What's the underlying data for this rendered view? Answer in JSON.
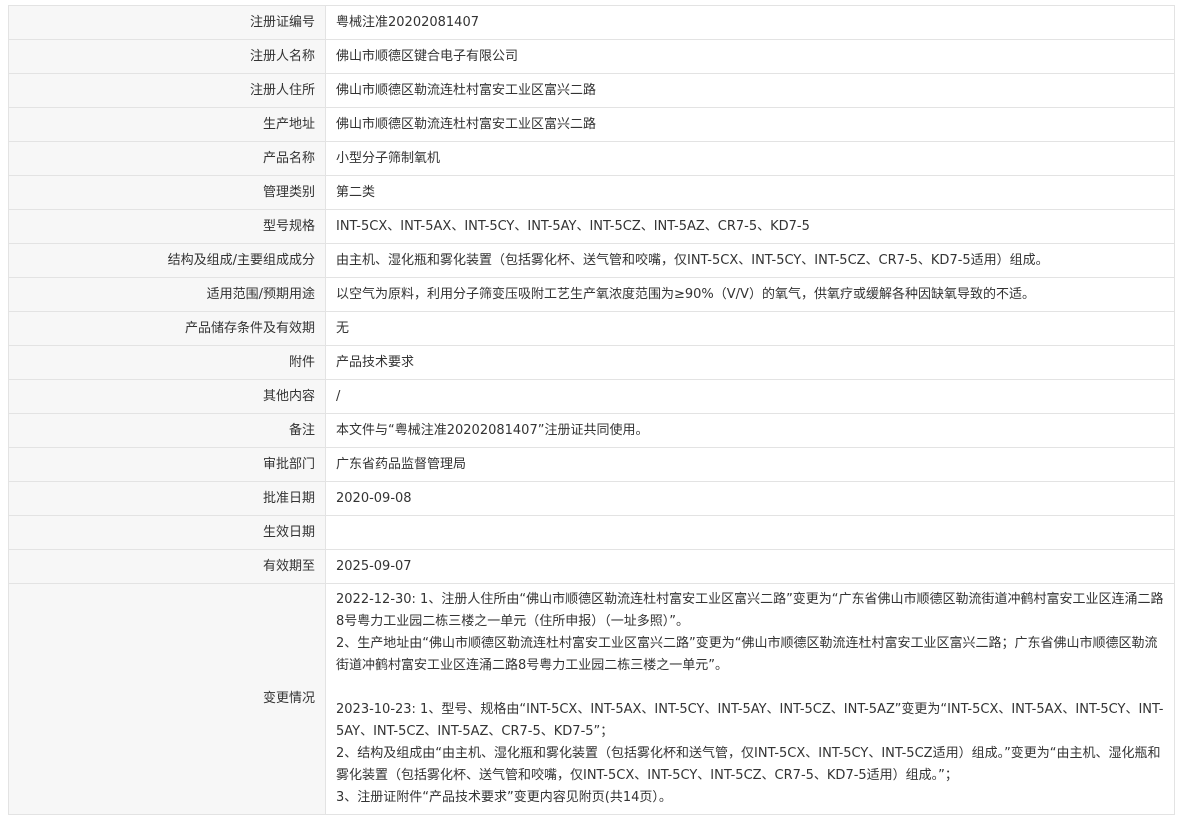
{
  "rows": [
    {
      "label": "注册证编号",
      "value": "粤械注准20202081407"
    },
    {
      "label": "注册人名称",
      "value": "佛山市顺德区键合电子有限公司"
    },
    {
      "label": "注册人住所",
      "value": "佛山市顺德区勒流连杜村富安工业区富兴二路"
    },
    {
      "label": "生产地址",
      "value": "佛山市顺德区勒流连杜村富安工业区富兴二路"
    },
    {
      "label": "产品名称",
      "value": "小型分子筛制氧机"
    },
    {
      "label": "管理类别",
      "value": "第二类"
    },
    {
      "label": "型号规格",
      "value": "INT-5CX、INT-5AX、INT-5CY、INT-5AY、INT-5CZ、INT-5AZ、CR7-5、KD7-5"
    },
    {
      "label": "结构及组成/主要组成成分",
      "value": "由主机、湿化瓶和雾化装置（包括雾化杯、送气管和咬嘴，仅INT-5CX、INT-5CY、INT-5CZ、CR7-5、KD7-5适用）组成。"
    },
    {
      "label": "适用范围/预期用途",
      "value": "以空气为原料，利用分子筛变压吸附工艺生产氧浓度范围为≥90%（V/V）的氧气，供氧疗或缓解各种因缺氧导致的不适。"
    },
    {
      "label": "产品储存条件及有效期",
      "value": "无"
    },
    {
      "label": "附件",
      "value": "产品技术要求"
    },
    {
      "label": "其他内容",
      "value": "/"
    },
    {
      "label": "备注",
      "value": "本文件与“粤械注准20202081407”注册证共同使用。"
    },
    {
      "label": "审批部门",
      "value": "广东省药品监督管理局"
    },
    {
      "label": "批准日期",
      "value": "2020-09-08"
    },
    {
      "label": "生效日期",
      "value": ""
    },
    {
      "label": "有效期至",
      "value": "2025-09-07"
    }
  ],
  "changes": {
    "label": "变更情况",
    "entry1_line1": "2022-12-30: 1、注册人住所由“佛山市顺德区勒流连杜村富安工业区富兴二路”变更为“广东省佛山市顺德区勒流街道冲鹤村富安工业区连涌二路8号粤力工业园二栋三楼之一单元（住所申报）（一址多照）”。",
    "entry1_line2": "2、生产地址由“佛山市顺德区勒流连杜村富安工业区富兴二路”变更为“佛山市顺德区勒流连杜村富安工业区富兴二路；广东省佛山市顺德区勒流街道冲鹤村富安工业区连涌二路8号粤力工业园二栋三楼之一单元”。",
    "entry2_line1": "2023-10-23: 1、型号、规格由“INT-5CX、INT-5AX、INT-5CY、INT-5AY、INT-5CZ、INT-5AZ”变更为“INT-5CX、INT-5AX、INT-5CY、INT-5AY、INT-5CZ、INT-5AZ、CR7-5、KD7-5”；",
    "entry2_line2": "2、结构及组成由“由主机、湿化瓶和雾化装置（包括雾化杯和送气管，仅INT-5CX、INT-5CY、INT-5CZ适用）组成。”变更为“由主机、湿化瓶和雾化装置（包括雾化杯、送气管和咬嘴，仅INT-5CX、INT-5CY、INT-5CZ、CR7-5、KD7-5适用）组成。”；",
    "entry2_line3": "3、注册证附件“产品技术要求”变更内容见附页(共14页）。"
  }
}
